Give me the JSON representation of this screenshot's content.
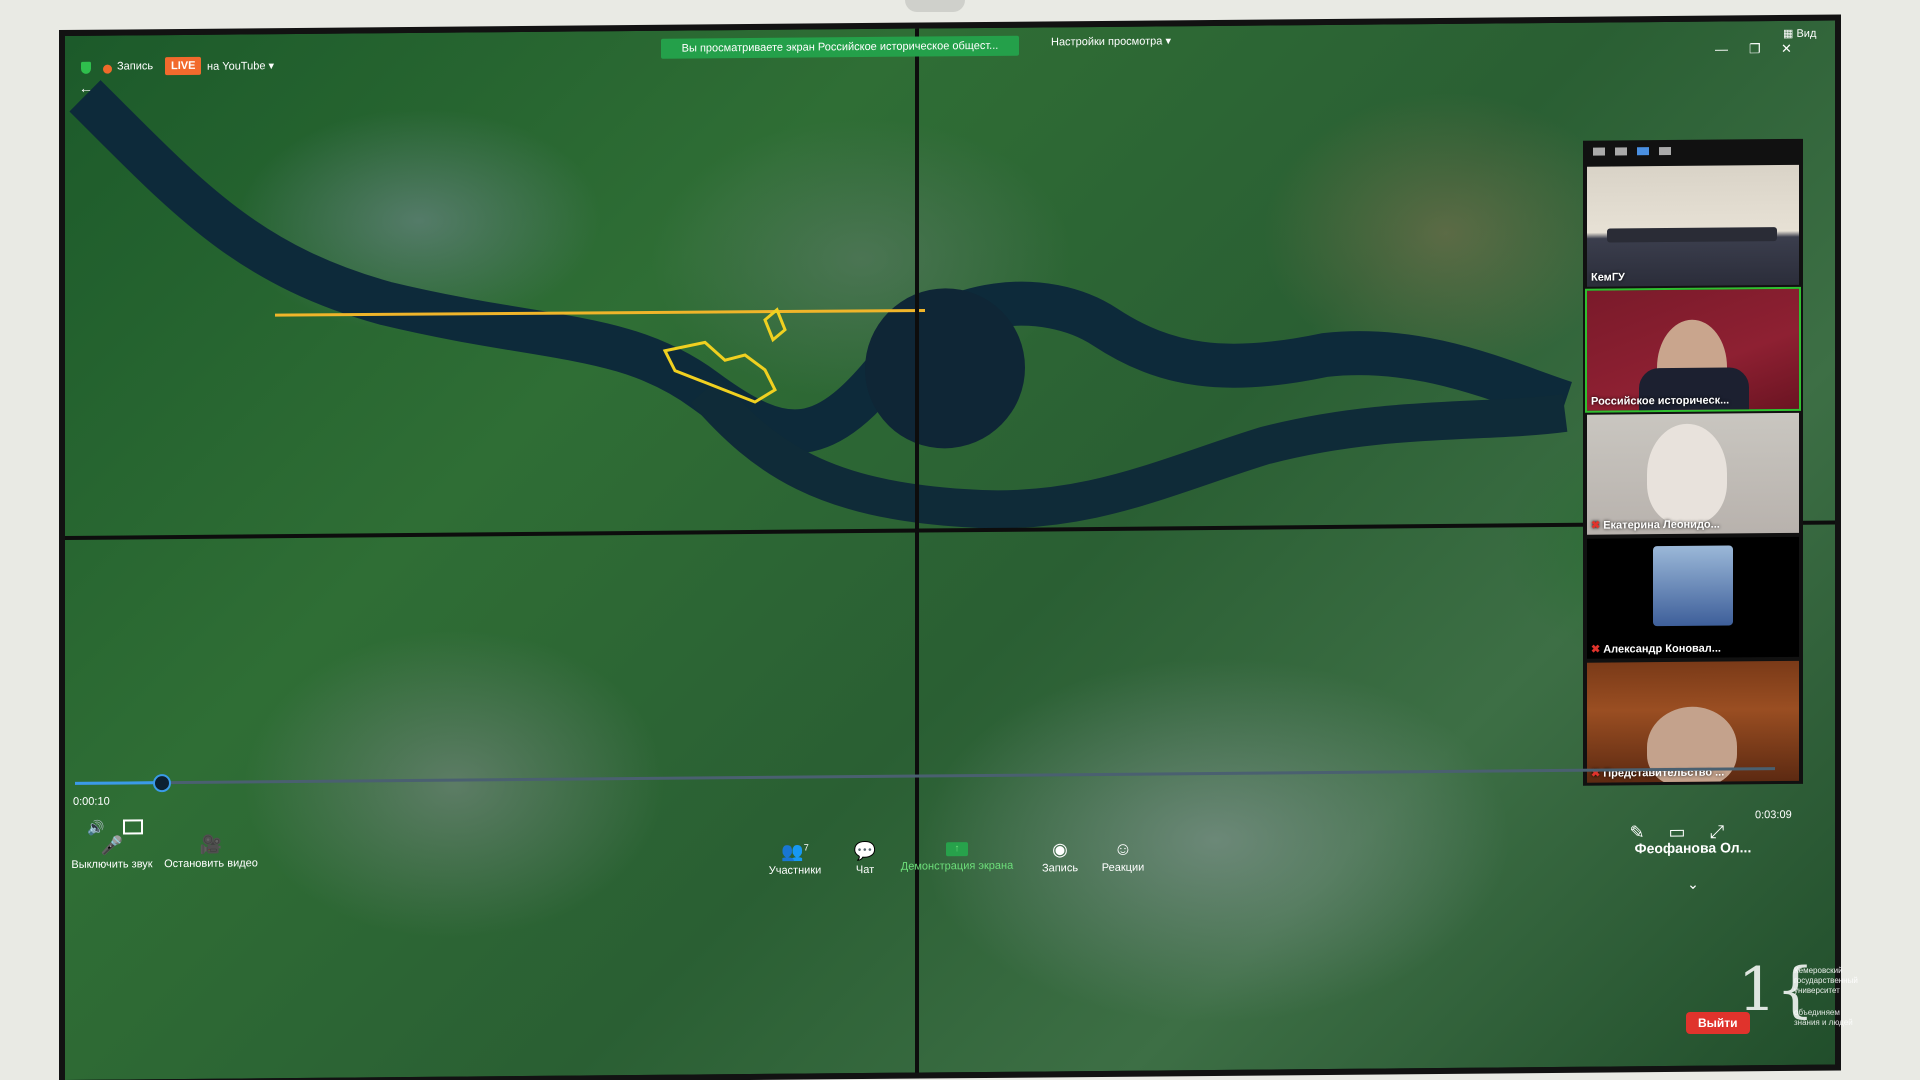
{
  "topbar": {
    "recording_label": "Запись",
    "live_badge": "LIVE",
    "youtube_label": "на YouTube",
    "share_banner": "Вы просматриваете экран Российское историческое общест...",
    "view_options": "Настройки просмотра",
    "view_button": "Вид"
  },
  "gallery": {
    "tiles": [
      {
        "name": "КемГУ",
        "muted": false
      },
      {
        "name": "Российское историческ...",
        "muted": false
      },
      {
        "name": "Екатерина Леонидо...",
        "muted": true
      },
      {
        "name": "Александр Коновал...",
        "muted": true
      },
      {
        "name": "Представительство ...",
        "muted": true
      }
    ],
    "extra_participant": "Феофанова Ол..."
  },
  "playback": {
    "elapsed": "0:00:10",
    "remaining": "0:03:09",
    "progress_fraction": 0.05
  },
  "toolbar": {
    "mute": "Выключить звук",
    "stop_video": "Остановить видео",
    "participants": "Участники",
    "participants_count": "7",
    "chat": "Чат",
    "share_screen": "Демонстрация экрана",
    "record": "Запись",
    "reactions": "Реакции",
    "leave": "Выйти"
  },
  "watermark": {
    "university": "Кемеровский государственный университет",
    "slogan": "объединяем знания и людей"
  },
  "colors": {
    "live": "#f26a2d",
    "share_banner": "#24a04a",
    "leave": "#e0332c",
    "progress": "#3a9be8",
    "highlight_track": "#f0b52a"
  }
}
